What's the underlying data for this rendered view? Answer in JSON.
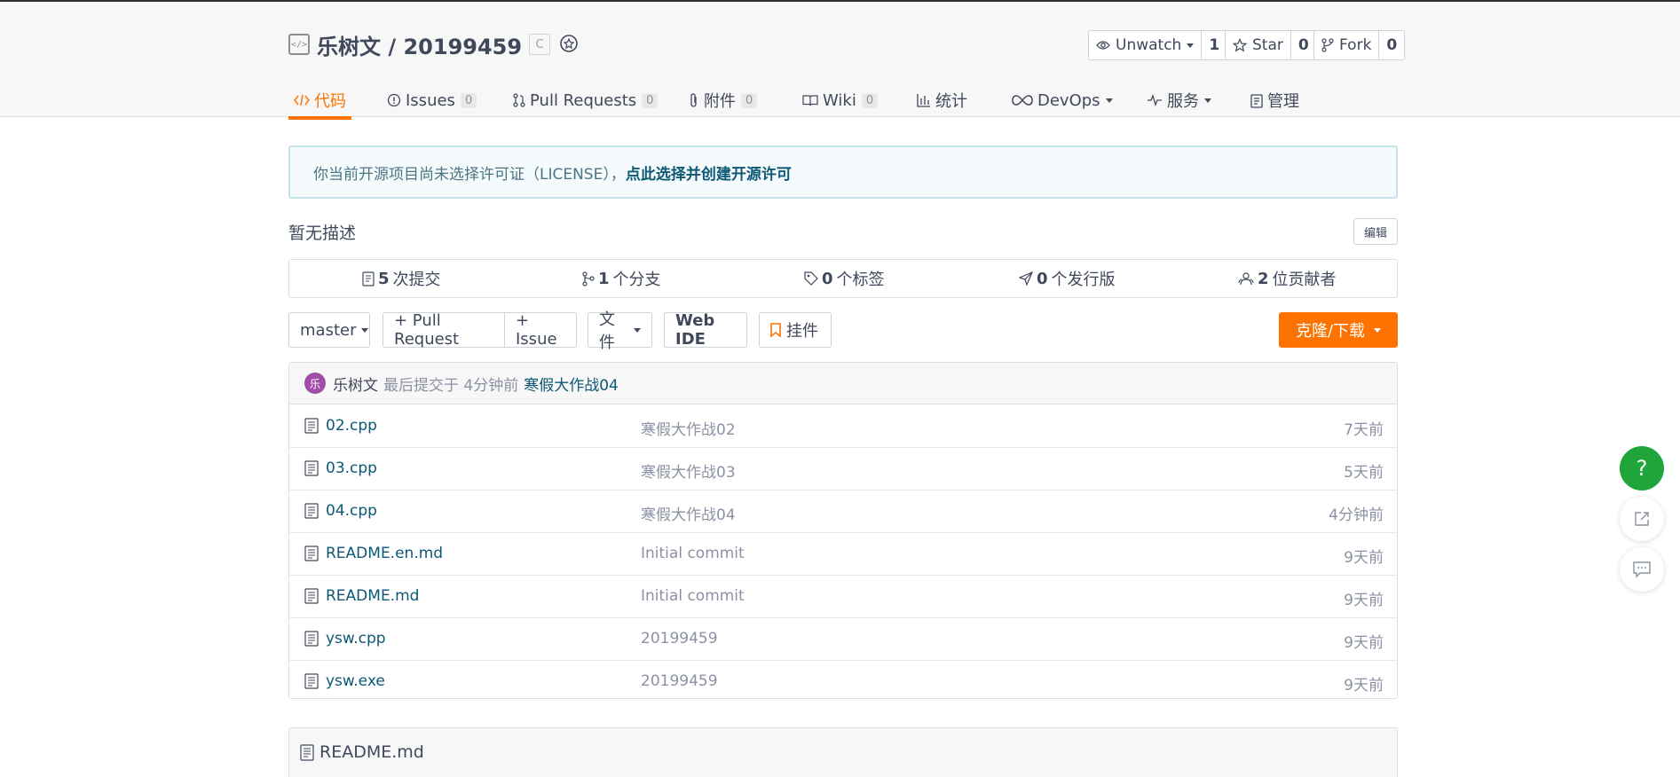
{
  "repo": {
    "owner": "乐树文",
    "separator": " / ",
    "name": "20199459",
    "lang_badge": "C"
  },
  "actions": {
    "watch": {
      "label": "Unwatch",
      "count": "1"
    },
    "star": {
      "label": "Star",
      "count": "0"
    },
    "fork": {
      "label": "Fork",
      "count": "0"
    }
  },
  "tabs": [
    {
      "label": "代码",
      "icon": "code-icon",
      "active": true
    },
    {
      "label": "Issues",
      "badge": "0",
      "icon": "issue-icon"
    },
    {
      "label": "Pull Requests",
      "badge": "0",
      "icon": "pull-request-icon"
    },
    {
      "label": "附件",
      "badge": "0",
      "icon": "paperclip-icon"
    },
    {
      "label": "Wiki",
      "badge": "0",
      "icon": "book-icon"
    },
    {
      "label": "统计",
      "icon": "bar-chart-icon"
    },
    {
      "label": "DevOps",
      "icon": "infinity-icon",
      "dropdown": true
    },
    {
      "label": "服务",
      "icon": "pulse-icon",
      "dropdown": true
    },
    {
      "label": "管理",
      "icon": "clipboard-icon"
    }
  ],
  "license_notice": {
    "text": "你当前开源项目尚未选择许可证（LICENSE），",
    "link": "点此选择并创建开源许可"
  },
  "description": "暂无描述",
  "edit_label": "编辑",
  "stats": [
    {
      "count": "5",
      "label": "次提交",
      "icon": "commit-icon"
    },
    {
      "count": "1",
      "label": "个分支",
      "icon": "branch-icon"
    },
    {
      "count": "0",
      "label": "个标签",
      "icon": "tag-icon"
    },
    {
      "count": "0",
      "label": "个发行版",
      "icon": "send-icon"
    },
    {
      "count": "2",
      "label": "位贡献者",
      "icon": "contributors-icon"
    }
  ],
  "toolbar": {
    "branch": "master",
    "pull_request": "+ Pull Request",
    "issue": "+ Issue",
    "file": "文件",
    "web_ide": "Web IDE",
    "widget": "挂件",
    "clone": "克隆/下载"
  },
  "last_commit": {
    "avatar_text": "乐",
    "author": "乐树文",
    "meta": "最后提交于 4分钟前",
    "message": "寒假大作战04",
    "avatar_color": "#a04ea8"
  },
  "files": [
    {
      "name": "02.cpp",
      "commit": "寒假大作战02",
      "time": "7天前"
    },
    {
      "name": "03.cpp",
      "commit": "寒假大作战03",
      "time": "5天前"
    },
    {
      "name": "04.cpp",
      "commit": "寒假大作战04",
      "time": "4分钟前"
    },
    {
      "name": "README.en.md",
      "commit": "Initial commit",
      "time": "9天前"
    },
    {
      "name": "README.md",
      "commit": "Initial commit",
      "time": "9天前"
    },
    {
      "name": "ysw.cpp",
      "commit": "20199459",
      "time": "9天前"
    },
    {
      "name": "ysw.exe",
      "commit": "20199459",
      "time": "9天前"
    }
  ],
  "readme_title": "README.md",
  "float_help": "?",
  "colors": {
    "accent": "#fe7300",
    "link": "#0c5876",
    "help": "#1fa53a"
  }
}
